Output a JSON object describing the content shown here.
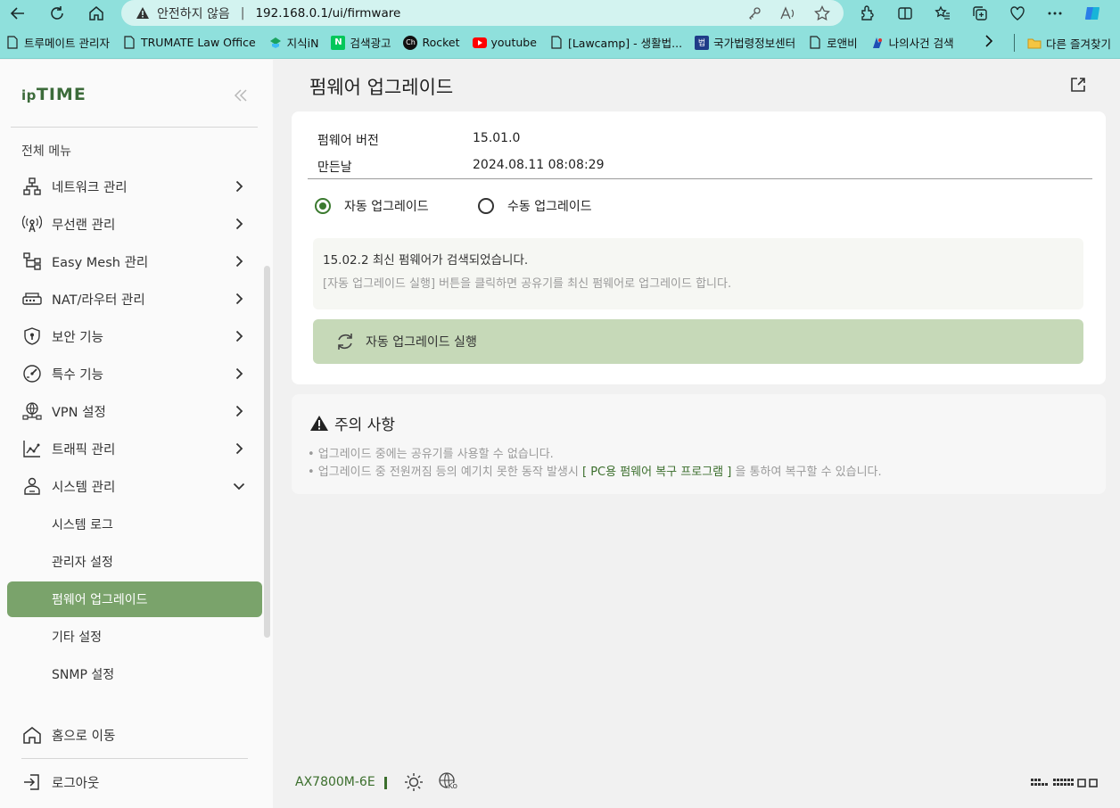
{
  "browser": {
    "address": {
      "security_label": "안전하지 않음",
      "separator": "|",
      "url": "192.168.0.1/ui/firmware"
    },
    "bookmarks": [
      {
        "label": "트루메이트 관리자",
        "icon": "page-icon"
      },
      {
        "label": "TRUMATE Law Office",
        "icon": "page-icon"
      },
      {
        "label": "지식iN",
        "icon": "jisik-icon"
      },
      {
        "label": "검색광고",
        "icon": "naver-icon"
      },
      {
        "label": "Rocket",
        "icon": "rocket-icon"
      },
      {
        "label": "youtube",
        "icon": "youtube-icon"
      },
      {
        "label": "[Lawcamp] - 생활법...",
        "icon": "page-icon"
      },
      {
        "label": "국가법령정보센터",
        "icon": "law-icon"
      },
      {
        "label": "로앤비",
        "icon": "page-icon"
      },
      {
        "label": "나의사건 검색",
        "icon": "court-icon"
      }
    ],
    "other_favorites": "다른 즐겨찾기"
  },
  "sidebar": {
    "heading": "전체 메뉴",
    "items": [
      {
        "label": "네트워크 관리",
        "icon": "network-icon"
      },
      {
        "label": "무선랜 관리",
        "icon": "wireless-icon"
      },
      {
        "label": "Easy Mesh 관리",
        "icon": "mesh-icon"
      },
      {
        "label": "NAT/라우터 관리",
        "icon": "router-icon"
      },
      {
        "label": "보안 기능",
        "icon": "shield-icon"
      },
      {
        "label": "특수 기능",
        "icon": "gauge-icon"
      },
      {
        "label": "VPN 설정",
        "icon": "vpn-icon"
      },
      {
        "label": "트래픽 관리",
        "icon": "traffic-icon"
      },
      {
        "label": "시스템 관리",
        "icon": "system-icon"
      }
    ],
    "sub_items": [
      {
        "label": "시스템 로그"
      },
      {
        "label": "관리자 설정"
      },
      {
        "label": "펌웨어 업그레이드"
      },
      {
        "label": "기타 설정"
      },
      {
        "label": "SNMP 설정"
      }
    ],
    "home": "홈으로 이동",
    "logout": "로그아웃"
  },
  "logo": {
    "prefix": "ip",
    "brand": "TIME"
  },
  "page": {
    "title": "펌웨어 업그레이드",
    "info": {
      "version_label": "펌웨어 버전",
      "version_value": "15.01.0",
      "date_label": "만든날",
      "date_value": "2024.08.11 08:08:29"
    },
    "radios": {
      "auto": "자동 업그레이드",
      "manual": "수동 업그레이드",
      "selected": "auto"
    },
    "notice": {
      "line1": "15.02.2 최신 펌웨어가 검색되었습니다.",
      "line2": "[자동 업그레이드 실행] 버튼을 클릭하면 공유기를 최신 펌웨어로 업그레이드 합니다."
    },
    "run_button": "자동 업그레이드 실행",
    "caution": {
      "title": "주의 사항",
      "line1": "• 업그레이드 중에는 공유기를 사용할 수 없습니다.",
      "line2_prefix": "• 업그레이드 중 전원꺼짐 등의 예기치 못한 동작 발생시",
      "line2_link": "[ PC용 펌웨어 복구 프로그램 ]",
      "line2_suffix": "을 통하여 복구할 수  있습니다."
    }
  },
  "footer": {
    "model": "AX7800M-6E",
    "language_badge": "Ko"
  },
  "colors": {
    "accent": "#7aa36b",
    "accent_dark": "#3b6e2c",
    "button_bg": "#c6d9b8",
    "browser_chrome": "#8fe0dc"
  }
}
